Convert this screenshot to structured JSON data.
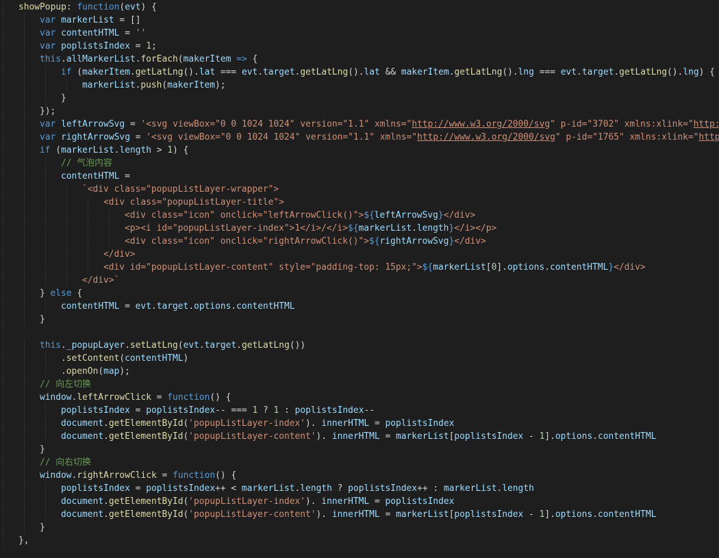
{
  "editor": {
    "theme_colors": {
      "background": "#1e1e1e",
      "keyword": "#569cd6",
      "function": "#dcdcaa",
      "variable": "#9cdcfe",
      "string": "#ce9178",
      "number": "#b5cea8",
      "comment": "#6a9955",
      "punctuation": "#d4d4d4"
    },
    "lines": [
      {
        "indent": 0,
        "tokens": [
          [
            "fn",
            "showPopup"
          ],
          [
            "pun",
            ": "
          ],
          [
            "kw",
            "function"
          ],
          [
            "pun",
            "("
          ],
          [
            "var",
            "evt"
          ],
          [
            "pun",
            ") {"
          ]
        ]
      },
      {
        "indent": 1,
        "tokens": [
          [
            "kw",
            "var"
          ],
          [
            "def",
            " "
          ],
          [
            "var",
            "markerList"
          ],
          [
            "op",
            " = "
          ],
          [
            "pun",
            "[]"
          ]
        ]
      },
      {
        "indent": 1,
        "tokens": [
          [
            "kw",
            "var"
          ],
          [
            "def",
            " "
          ],
          [
            "var",
            "contentHTML"
          ],
          [
            "op",
            " = "
          ],
          [
            "str",
            "''"
          ]
        ]
      },
      {
        "indent": 1,
        "tokens": [
          [
            "kw",
            "var"
          ],
          [
            "def",
            " "
          ],
          [
            "var",
            "poplistsIndex"
          ],
          [
            "op",
            " = "
          ],
          [
            "num",
            "1"
          ],
          [
            "pun",
            ";"
          ]
        ]
      },
      {
        "indent": 1,
        "tokens": [
          [
            "kw",
            "this"
          ],
          [
            "pun",
            "."
          ],
          [
            "prop",
            "allMarkerList"
          ],
          [
            "pun",
            "."
          ],
          [
            "fn",
            "forEach"
          ],
          [
            "pun",
            "("
          ],
          [
            "var",
            "makerItem"
          ],
          [
            "kw",
            " =>"
          ],
          [
            "pun",
            " {"
          ]
        ]
      },
      {
        "indent": 2,
        "tokens": [
          [
            "kw",
            "if"
          ],
          [
            "pun",
            " ("
          ],
          [
            "var",
            "makerItem"
          ],
          [
            "pun",
            "."
          ],
          [
            "fn",
            "getLatLng"
          ],
          [
            "pun",
            "()."
          ],
          [
            "prop",
            "lat"
          ],
          [
            "op",
            " === "
          ],
          [
            "var",
            "evt"
          ],
          [
            "pun",
            "."
          ],
          [
            "prop",
            "target"
          ],
          [
            "pun",
            "."
          ],
          [
            "fn",
            "getLatLng"
          ],
          [
            "pun",
            "()."
          ],
          [
            "prop",
            "lat"
          ],
          [
            "op",
            " && "
          ],
          [
            "var",
            "makerItem"
          ],
          [
            "pun",
            "."
          ],
          [
            "fn",
            "getLatLng"
          ],
          [
            "pun",
            "()."
          ],
          [
            "prop",
            "lng"
          ],
          [
            "op",
            " === "
          ],
          [
            "var",
            "evt"
          ],
          [
            "pun",
            "."
          ],
          [
            "prop",
            "target"
          ],
          [
            "pun",
            "."
          ],
          [
            "fn",
            "getLatLng"
          ],
          [
            "pun",
            "()."
          ],
          [
            "prop",
            "lng"
          ],
          [
            "pun",
            ") {"
          ]
        ]
      },
      {
        "indent": 3,
        "tokens": [
          [
            "var",
            "markerList"
          ],
          [
            "pun",
            "."
          ],
          [
            "fn",
            "push"
          ],
          [
            "pun",
            "("
          ],
          [
            "var",
            "makerItem"
          ],
          [
            "pun",
            ");"
          ]
        ]
      },
      {
        "indent": 2,
        "tokens": [
          [
            "pun",
            "}"
          ]
        ]
      },
      {
        "indent": 1,
        "tokens": [
          [
            "pun",
            "});"
          ]
        ]
      },
      {
        "indent": 1,
        "tokens": [
          [
            "kw",
            "var"
          ],
          [
            "def",
            " "
          ],
          [
            "var",
            "leftArrowSvg"
          ],
          [
            "op",
            " = "
          ],
          [
            "str",
            "'<svg viewBox=\"0 0 1024 1024\" version=\"1.1\" xmlns=\""
          ],
          [
            "url",
            "http://www.w3.org/2000/svg"
          ],
          [
            "str",
            "\" p-id=\"3702\" xmlns:xlink=\""
          ],
          [
            "url",
            "http:/"
          ]
        ]
      },
      {
        "indent": 1,
        "tokens": [
          [
            "kw",
            "var"
          ],
          [
            "def",
            " "
          ],
          [
            "var",
            "rightArrowSvg"
          ],
          [
            "op",
            " = "
          ],
          [
            "str",
            "'<svg viewBox=\"0 0 1024 1024\" version=\"1.1\" xmlns=\""
          ],
          [
            "url",
            "http://www.w3.org/2000/svg"
          ],
          [
            "str",
            "\" p-id=\"1765\" xmlns:xlink=\""
          ],
          [
            "url",
            "http:"
          ]
        ]
      },
      {
        "indent": 1,
        "tokens": [
          [
            "kw",
            "if"
          ],
          [
            "pun",
            " ("
          ],
          [
            "var",
            "markerList"
          ],
          [
            "pun",
            "."
          ],
          [
            "prop",
            "length"
          ],
          [
            "op",
            " > "
          ],
          [
            "num",
            "1"
          ],
          [
            "pun",
            ") {"
          ]
        ]
      },
      {
        "indent": 2,
        "tokens": [
          [
            "cmt",
            "// 气泡内容"
          ]
        ]
      },
      {
        "indent": 2,
        "tokens": [
          [
            "var",
            "contentHTML"
          ],
          [
            "op",
            " ="
          ]
        ]
      },
      {
        "indent": 3,
        "tokens": [
          [
            "str",
            "`<div class=\"popupListLayer-wrapper\">"
          ]
        ]
      },
      {
        "indent": 4,
        "tokens": [
          [
            "str",
            "<div class=\"popupListLayer-title\">"
          ]
        ]
      },
      {
        "indent": 5,
        "tokens": [
          [
            "str",
            "<div class=\"icon\" onclick=\"leftArrowClick()\">"
          ],
          [
            "tpl",
            "${"
          ],
          [
            "var",
            "leftArrowSvg"
          ],
          [
            "tpl",
            "}"
          ],
          [
            "str",
            "</div>"
          ]
        ]
      },
      {
        "indent": 5,
        "tokens": [
          [
            "str",
            "<p><i id=\"popupListLayer-index\">1</i>/</i>"
          ],
          [
            "tpl",
            "${"
          ],
          [
            "var",
            "markerList"
          ],
          [
            "pun",
            "."
          ],
          [
            "prop",
            "length"
          ],
          [
            "tpl",
            "}"
          ],
          [
            "str",
            "</i></p>"
          ]
        ]
      },
      {
        "indent": 5,
        "tokens": [
          [
            "str",
            "<div class=\"icon\" onclick=\"rightArrowClick()\">"
          ],
          [
            "tpl",
            "${"
          ],
          [
            "var",
            "rightArrowSvg"
          ],
          [
            "tpl",
            "}"
          ],
          [
            "str",
            "</div>"
          ]
        ]
      },
      {
        "indent": 4,
        "tokens": [
          [
            "str",
            "</div>"
          ]
        ]
      },
      {
        "indent": 4,
        "tokens": [
          [
            "str",
            "<div id=\"popupListLayer-content\" style=\"padding-top: 15px;\">"
          ],
          [
            "tpl",
            "${"
          ],
          [
            "var",
            "markerList"
          ],
          [
            "pun",
            "["
          ],
          [
            "num",
            "0"
          ],
          [
            "pun",
            "]."
          ],
          [
            "prop",
            "options"
          ],
          [
            "pun",
            "."
          ],
          [
            "prop",
            "contentHTML"
          ],
          [
            "tpl",
            "}"
          ],
          [
            "str",
            "</div>"
          ]
        ]
      },
      {
        "indent": 3,
        "tokens": [
          [
            "str",
            "</div>`"
          ]
        ]
      },
      {
        "indent": 1,
        "tokens": [
          [
            "pun",
            "} "
          ],
          [
            "kw",
            "else"
          ],
          [
            "pun",
            " {"
          ]
        ]
      },
      {
        "indent": 2,
        "tokens": [
          [
            "var",
            "contentHTML"
          ],
          [
            "op",
            " = "
          ],
          [
            "var",
            "evt"
          ],
          [
            "pun",
            "."
          ],
          [
            "prop",
            "target"
          ],
          [
            "pun",
            "."
          ],
          [
            "prop",
            "options"
          ],
          [
            "pun",
            "."
          ],
          [
            "prop",
            "contentHTML"
          ]
        ]
      },
      {
        "indent": 1,
        "tokens": [
          [
            "pun",
            "}"
          ]
        ]
      },
      {
        "indent": 0,
        "tokens": []
      },
      {
        "indent": 1,
        "tokens": [
          [
            "kw",
            "this"
          ],
          [
            "pun",
            "."
          ],
          [
            "prop",
            "_popupLayer"
          ],
          [
            "pun",
            "."
          ],
          [
            "fn",
            "setLatLng"
          ],
          [
            "pun",
            "("
          ],
          [
            "var",
            "evt"
          ],
          [
            "pun",
            "."
          ],
          [
            "prop",
            "target"
          ],
          [
            "pun",
            "."
          ],
          [
            "fn",
            "getLatLng"
          ],
          [
            "pun",
            "())"
          ]
        ]
      },
      {
        "indent": 2,
        "tokens": [
          [
            "pun",
            "."
          ],
          [
            "fn",
            "setContent"
          ],
          [
            "pun",
            "("
          ],
          [
            "var",
            "contentHTML"
          ],
          [
            "pun",
            ")"
          ]
        ]
      },
      {
        "indent": 2,
        "tokens": [
          [
            "pun",
            "."
          ],
          [
            "fn",
            "openOn"
          ],
          [
            "pun",
            "("
          ],
          [
            "var",
            "map"
          ],
          [
            "pun",
            ");"
          ]
        ]
      },
      {
        "indent": 1,
        "tokens": [
          [
            "cmt",
            "// 向左切换"
          ]
        ]
      },
      {
        "indent": 1,
        "tokens": [
          [
            "var",
            "window"
          ],
          [
            "pun",
            "."
          ],
          [
            "fn",
            "leftArrowClick"
          ],
          [
            "op",
            " = "
          ],
          [
            "kw",
            "function"
          ],
          [
            "pun",
            "() {"
          ]
        ]
      },
      {
        "indent": 2,
        "tokens": [
          [
            "var",
            "poplistsIndex"
          ],
          [
            "op",
            " = "
          ],
          [
            "var",
            "poplistsIndex"
          ],
          [
            "op",
            "-- === "
          ],
          [
            "num",
            "1"
          ],
          [
            "op",
            " ? "
          ],
          [
            "num",
            "1"
          ],
          [
            "op",
            " : "
          ],
          [
            "var",
            "poplistsIndex"
          ],
          [
            "op",
            "--"
          ]
        ]
      },
      {
        "indent": 2,
        "tokens": [
          [
            "var",
            "document"
          ],
          [
            "pun",
            "."
          ],
          [
            "fn",
            "getElementById"
          ],
          [
            "pun",
            "("
          ],
          [
            "str",
            "'popupListLayer-index'"
          ],
          [
            "pun",
            "). "
          ],
          [
            "prop",
            "innerHTML"
          ],
          [
            "op",
            " = "
          ],
          [
            "var",
            "poplistsIndex"
          ]
        ]
      },
      {
        "indent": 2,
        "tokens": [
          [
            "var",
            "document"
          ],
          [
            "pun",
            "."
          ],
          [
            "fn",
            "getElementById"
          ],
          [
            "pun",
            "("
          ],
          [
            "str",
            "'popupListLayer-content'"
          ],
          [
            "pun",
            "). "
          ],
          [
            "prop",
            "innerHTML"
          ],
          [
            "op",
            " = "
          ],
          [
            "var",
            "markerList"
          ],
          [
            "pun",
            "["
          ],
          [
            "var",
            "poplistsIndex"
          ],
          [
            "op",
            " - "
          ],
          [
            "num",
            "1"
          ],
          [
            "pun",
            "]."
          ],
          [
            "prop",
            "options"
          ],
          [
            "pun",
            "."
          ],
          [
            "prop",
            "contentHTML"
          ]
        ]
      },
      {
        "indent": 1,
        "tokens": [
          [
            "pun",
            "}"
          ]
        ]
      },
      {
        "indent": 1,
        "tokens": [
          [
            "cmt",
            "// 向右切换"
          ]
        ]
      },
      {
        "indent": 1,
        "tokens": [
          [
            "var",
            "window"
          ],
          [
            "pun",
            "."
          ],
          [
            "fn",
            "rightArrowClick"
          ],
          [
            "op",
            " = "
          ],
          [
            "kw",
            "function"
          ],
          [
            "pun",
            "() {"
          ]
        ]
      },
      {
        "indent": 2,
        "tokens": [
          [
            "var",
            "poplistsIndex"
          ],
          [
            "op",
            " = "
          ],
          [
            "var",
            "poplistsIndex"
          ],
          [
            "op",
            "++ < "
          ],
          [
            "var",
            "markerList"
          ],
          [
            "pun",
            "."
          ],
          [
            "prop",
            "length"
          ],
          [
            "op",
            " ? "
          ],
          [
            "var",
            "poplistsIndex"
          ],
          [
            "op",
            "++ : "
          ],
          [
            "var",
            "markerList"
          ],
          [
            "pun",
            "."
          ],
          [
            "prop",
            "length"
          ]
        ]
      },
      {
        "indent": 2,
        "tokens": [
          [
            "var",
            "document"
          ],
          [
            "pun",
            "."
          ],
          [
            "fn",
            "getElementById"
          ],
          [
            "pun",
            "("
          ],
          [
            "str",
            "'popupListLayer-index'"
          ],
          [
            "pun",
            "). "
          ],
          [
            "prop",
            "innerHTML"
          ],
          [
            "op",
            " = "
          ],
          [
            "var",
            "poplistsIndex"
          ]
        ]
      },
      {
        "indent": 2,
        "tokens": [
          [
            "var",
            "document"
          ],
          [
            "pun",
            "."
          ],
          [
            "fn",
            "getElementById"
          ],
          [
            "pun",
            "("
          ],
          [
            "str",
            "'popupListLayer-content'"
          ],
          [
            "pun",
            "). "
          ],
          [
            "prop",
            "innerHTML"
          ],
          [
            "op",
            " = "
          ],
          [
            "var",
            "markerList"
          ],
          [
            "pun",
            "["
          ],
          [
            "var",
            "poplistsIndex"
          ],
          [
            "op",
            " - "
          ],
          [
            "num",
            "1"
          ],
          [
            "pun",
            "]."
          ],
          [
            "prop",
            "options"
          ],
          [
            "pun",
            "."
          ],
          [
            "prop",
            "contentHTML"
          ]
        ]
      },
      {
        "indent": 1,
        "tokens": [
          [
            "pun",
            "}"
          ]
        ]
      },
      {
        "indent": 0,
        "tokens": [
          [
            "pun",
            "},"
          ]
        ]
      }
    ]
  }
}
